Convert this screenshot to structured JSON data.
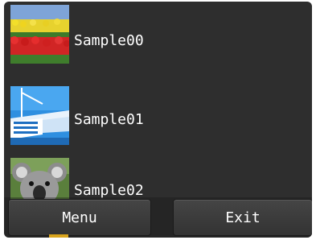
{
  "list": {
    "items": [
      {
        "label": "Sample00",
        "thumbnail": "tulip-field-photo"
      },
      {
        "label": "Sample01",
        "thumbnail": "ship-deck-photo"
      },
      {
        "label": "Sample02",
        "thumbnail": "koala-photo"
      }
    ]
  },
  "softkeys": {
    "left_label": "Menu",
    "right_label": "Exit"
  },
  "colors": {
    "screen_bg": "#2e2e2e",
    "text": "#ffffff",
    "button_bg": "#3c3c3c"
  }
}
